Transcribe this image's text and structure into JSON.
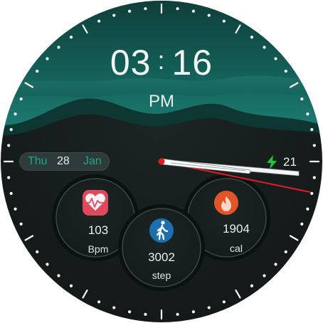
{
  "time": {
    "hours": "03",
    "separator": ":",
    "minutes": "16",
    "period": "PM"
  },
  "date": {
    "weekday": "Thu",
    "day": "28",
    "month": "Jan"
  },
  "battery": {
    "level": "21",
    "icon": "charging-bolt-icon"
  },
  "complications": {
    "heart_rate": {
      "value": "103",
      "unit": "Bpm",
      "icon": "heart-pulse-icon"
    },
    "calories": {
      "value": "1904",
      "unit": "cal",
      "icon": "flame-icon"
    },
    "steps": {
      "value": "3002",
      "unit": "step",
      "icon": "walking-person-icon"
    }
  },
  "colors": {
    "accent_teal": "#18a98a",
    "heart_icon_red": "#e0485e",
    "flame_icon_orange": "#e0562a",
    "second_hand_red": "#e31b23",
    "battery_green": "#22c63a",
    "hand_white": "#f5f5f5"
  },
  "hands": {
    "hour_hand_direction_deg": 95,
    "minute_hand_direction_deg": 98,
    "second_hand_direction_deg": 110
  }
}
